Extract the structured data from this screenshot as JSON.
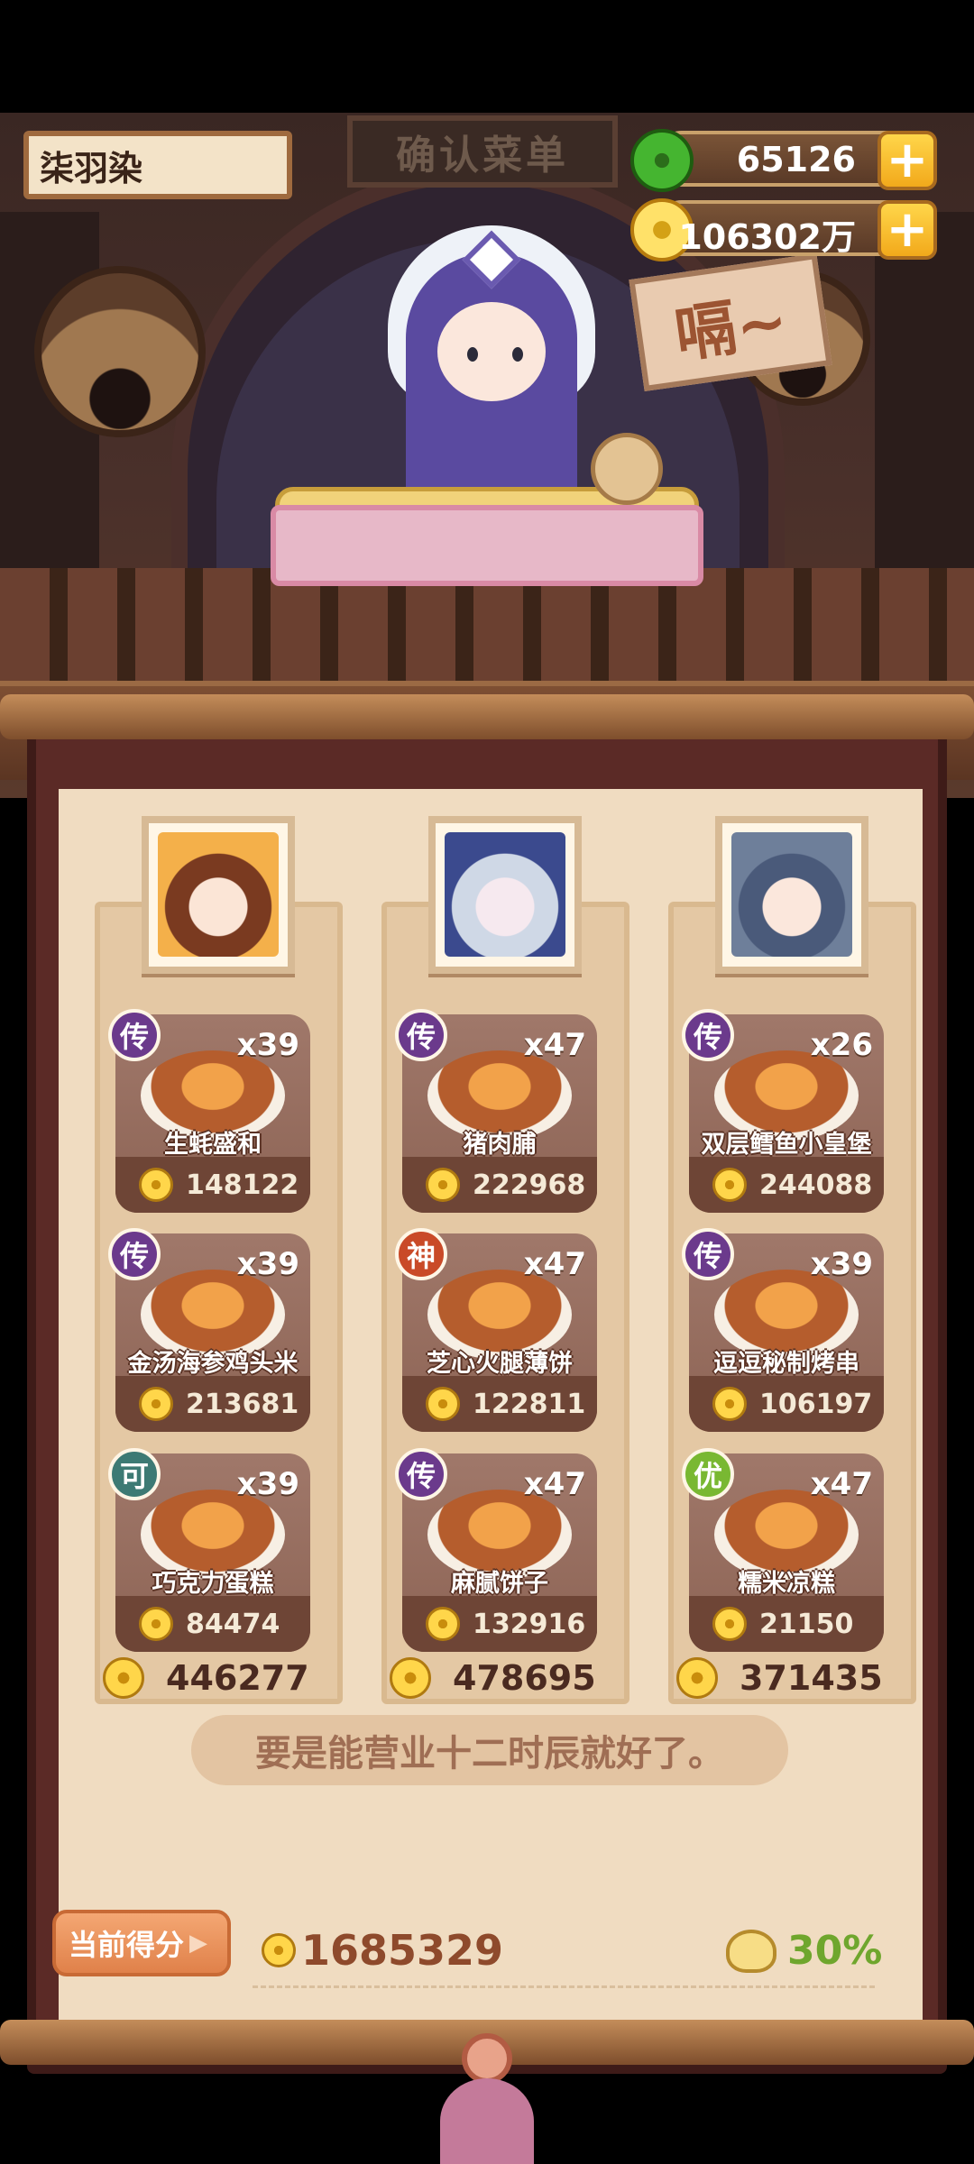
{
  "player": {
    "name": "柒羽染"
  },
  "resources": {
    "jade": {
      "value": "65126",
      "plus": "+"
    },
    "gold": {
      "value": "106302万",
      "plus": "+"
    }
  },
  "scene": {
    "sign": "确认菜单",
    "exclaim": "嗝~"
  },
  "columns": [
    {
      "dishes": [
        {
          "grade": "传",
          "qty": "x39",
          "name": "生蚝盛和",
          "price": "148122"
        },
        {
          "grade": "传",
          "qty": "x39",
          "name": "金汤海参鸡头米",
          "price": "213681"
        },
        {
          "grade": "可",
          "qty": "x39",
          "name": "巧克力蛋糕",
          "price": "84474"
        }
      ],
      "total": "446277"
    },
    {
      "dishes": [
        {
          "grade": "传",
          "qty": "x47",
          "name": "猪肉脯",
          "price": "222968"
        },
        {
          "grade": "神",
          "qty": "x47",
          "name": "芝心火腿薄饼",
          "price": "122811"
        },
        {
          "grade": "传",
          "qty": "x47",
          "name": "麻腻饼子",
          "price": "132916"
        }
      ],
      "total": "478695"
    },
    {
      "dishes": [
        {
          "grade": "传",
          "qty": "x26",
          "name": "双层鳕鱼小皇堡",
          "price": "244088"
        },
        {
          "grade": "传",
          "qty": "x39",
          "name": "逗逗秘制烤串",
          "price": "106197"
        },
        {
          "grade": "优",
          "qty": "x47",
          "name": "糯米凉糕",
          "price": "21150"
        }
      ],
      "total": "371435"
    }
  ],
  "quote": "要是能营业十二时辰就好了。",
  "score": {
    "button_label": "当前得分",
    "arrow": "▶",
    "value": "1685329",
    "bonus": "30%"
  }
}
